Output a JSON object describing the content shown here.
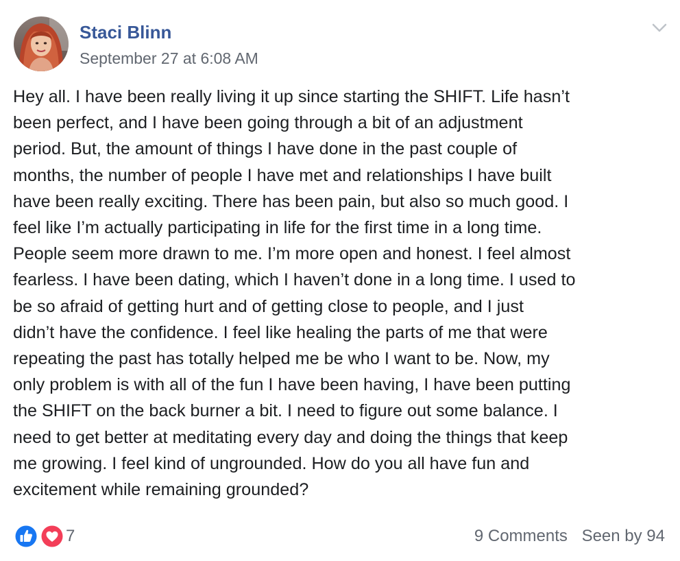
{
  "post": {
    "author": "Staci Blinn",
    "timestamp": "September 27 at 6:08 AM",
    "avatar_icon": "profile-photo",
    "menu_icon": "chevron-down-icon",
    "body_lines": [
      "Hey all. I have been really living it up since starting the SHIFT. Life hasn’t",
      "been perfect, and I have been going through a bit of an adjustment",
      "period. But, the amount of things I have done in the past couple of",
      "months, the number of people I have met and relationships I have built",
      "have been really exciting. There has been pain, but also so much good. I",
      "feel like I’m actually participating in life for the first time in a long time.",
      "People seem more drawn to me. I’m more open and honest. I feel almost",
      "fearless. I have been dating, which I haven’t done in a long time. I used to",
      "be so afraid of getting hurt and of getting close to people, and I just",
      "didn’t have the confidence. I feel like healing the parts of me that were",
      "repeating the past has totally helped me be who I want to be. Now, my",
      "only problem is with all of the fun I have been having, I have been putting",
      "the SHIFT on the back burner a bit. I need to figure out some balance. I",
      "need to get better at meditating every day and doing the things that keep",
      "me growing. I feel kind of ungrounded. How do you all have fun and",
      "excitement while remaining grounded?"
    ]
  },
  "footer": {
    "reaction_icons": [
      "like-icon",
      "love-icon"
    ],
    "reaction_count": "7",
    "comments": "9 Comments",
    "seen_by": "Seen by 94"
  },
  "colors": {
    "author_link": "#385898",
    "secondary_text": "#616770",
    "body_text": "#1c1e21",
    "like_blue": "#1877f2",
    "love_red": "#f33e58"
  }
}
